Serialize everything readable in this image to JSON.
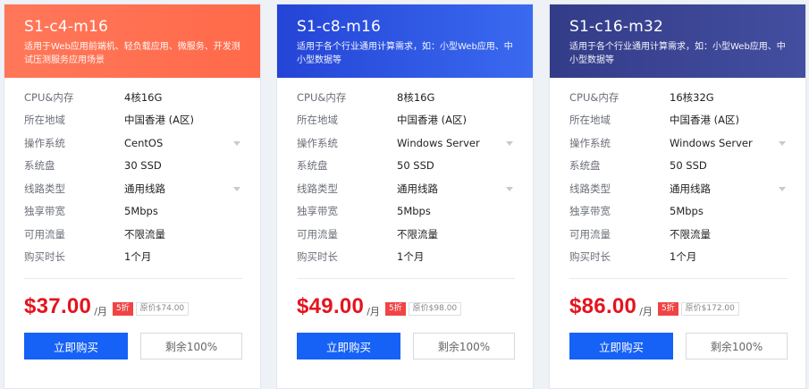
{
  "labels": {
    "cpu": "CPU&内存",
    "region": "所在地域",
    "os": "操作系统",
    "disk": "系统盘",
    "line": "线路类型",
    "bandwidth": "独享带宽",
    "traffic": "可用流量",
    "duration": "购买时长",
    "per_month": "/月",
    "buy": "立即购买"
  },
  "colors": {
    "card0_header": "#ff6a4a",
    "card1_header": "#2f5ae8",
    "card2_header": "#3a4494",
    "price_red": "#e4141e",
    "buy_blue": "#1661f6"
  },
  "cards": [
    {
      "title": "S1-c4-m16",
      "desc": "适用于Web应用前端机、轻负载应用、微服务、开发测试压测服务应用场景",
      "cpu": "4核16G",
      "region": "中国香港 (A区)",
      "os": "CentOS",
      "disk": "30 SSD",
      "line": "通用线路",
      "bandwidth": "5Mbps",
      "traffic": "不限流量",
      "duration": "1个月",
      "price": "$37.00",
      "discount": "5折",
      "orig_price": "原价$74.00",
      "remain": "剩余100%"
    },
    {
      "title": "S1-c8-m16",
      "desc": "适用于各个行业通用计算需求，如：小型Web应用、中小型数据等",
      "cpu": "8核16G",
      "region": "中国香港 (A区)",
      "os": "Windows Server",
      "disk": "50 SSD",
      "line": "通用线路",
      "bandwidth": "5Mbps",
      "traffic": "不限流量",
      "duration": "1个月",
      "price": "$49.00",
      "discount": "5折",
      "orig_price": "原价$98.00",
      "remain": "剩余100%"
    },
    {
      "title": "S1-c16-m32",
      "desc": "适用于各个行业通用计算需求，如：小型Web应用、中小型数据等",
      "cpu": "16核32G",
      "region": "中国香港 (A区)",
      "os": "Windows Server",
      "disk": "50 SSD",
      "line": "通用线路",
      "bandwidth": "5Mbps",
      "traffic": "不限流量",
      "duration": "1个月",
      "price": "$86.00",
      "discount": "5折",
      "orig_price": "原价$172.00",
      "remain": "剩余100%"
    }
  ]
}
